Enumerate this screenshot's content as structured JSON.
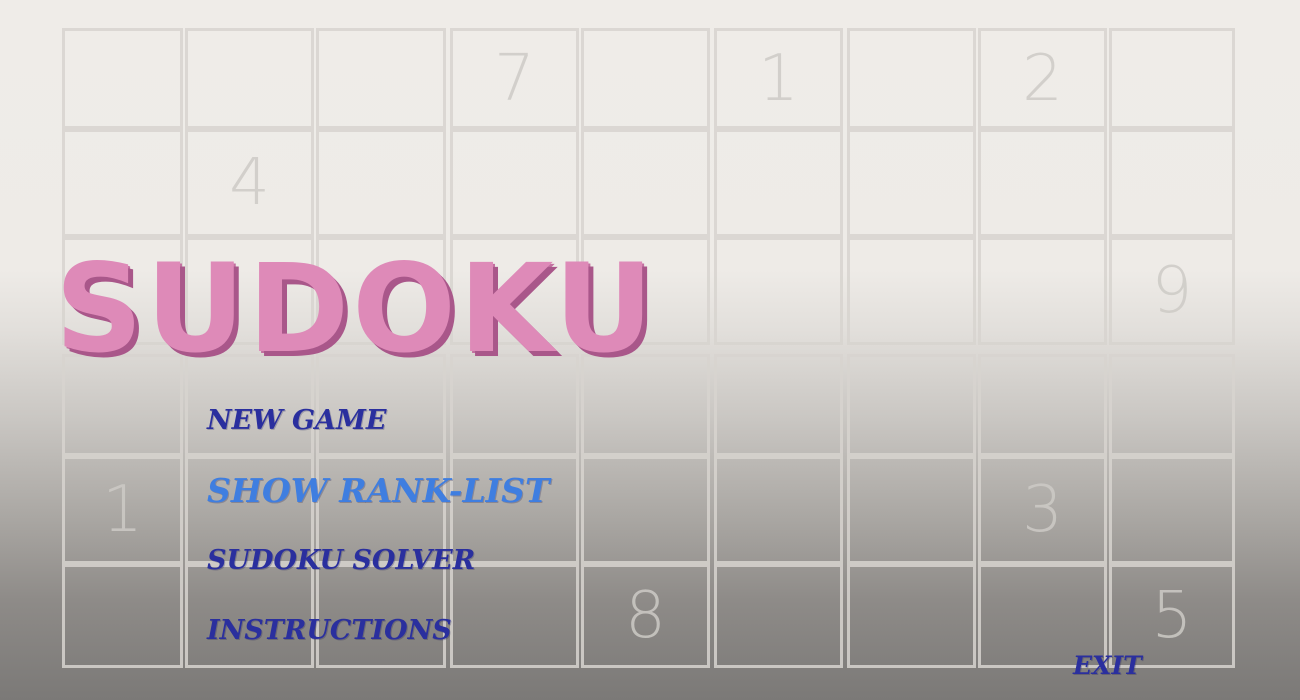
{
  "title": "SUDOKU",
  "menu": {
    "new_game": "NEW GAME",
    "show_rank_list": "SHOW RANK-LIST",
    "sudoku_solver": "SUDOKU SOLVER",
    "instructions": "INSTRUCTIONS",
    "exit": "EXIT"
  },
  "colors": {
    "title": "#de8ab8",
    "title_shadow": "#a9578a",
    "menu_text": "#2a2f9e",
    "menu_active": "#3f7ee0",
    "grid_line": "#d7d4cf"
  },
  "background_grid": {
    "rows": 6,
    "cols": 9,
    "cells": [
      [
        "",
        "",
        "",
        "7",
        "",
        "1",
        "",
        "2",
        ""
      ],
      [
        "",
        "4",
        "",
        "",
        "",
        "",
        "",
        "",
        ""
      ],
      [
        "",
        "",
        "",
        "",
        "",
        "",
        "",
        "",
        "9"
      ],
      [
        "",
        "",
        "",
        "",
        "",
        "",
        "",
        "",
        ""
      ],
      [
        "1",
        "",
        "",
        "",
        "",
        "",
        "",
        "3",
        ""
      ],
      [
        "",
        "",
        "",
        "",
        "8",
        "",
        "",
        "",
        "5"
      ]
    ]
  }
}
